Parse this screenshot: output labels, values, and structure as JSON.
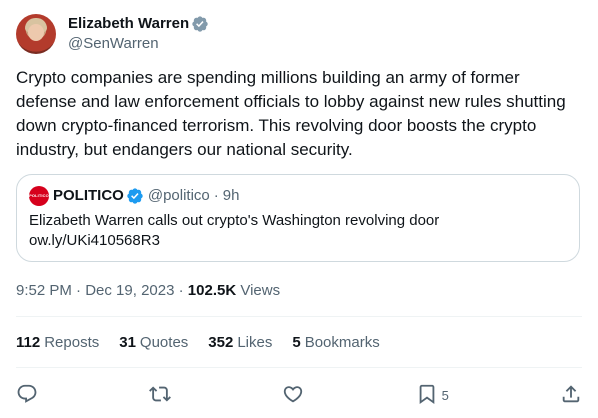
{
  "author": {
    "display_name": "Elizabeth Warren",
    "handle": "@SenWarren",
    "verified": true
  },
  "tweet": {
    "text": "Crypto companies are spending millions building an army of former defense and law enforcement officials to lobby against new rules shutting down crypto-financed terrorism. This revolving door boosts the crypto industry, but endangers our national security."
  },
  "quote": {
    "logo_text": "POLITICO",
    "name": "POLITICO",
    "handle": "@politico",
    "separator": "·",
    "time": "9h",
    "line1": "Elizabeth Warren calls out crypto's Washington revolving door",
    "line2": "ow.ly/UKi410568R3"
  },
  "meta": {
    "time": "9:52 PM",
    "sep1": " · ",
    "date": "Dec 19, 2023",
    "sep2": " · ",
    "views": "102.5K",
    "views_label": " Views"
  },
  "stats": {
    "reposts": {
      "count": "112",
      "label": "Reposts"
    },
    "quotes": {
      "count": "31",
      "label": "Quotes"
    },
    "likes": {
      "count": "352",
      "label": "Likes"
    },
    "bookmarks": {
      "count": "5",
      "label": "Bookmarks"
    }
  },
  "actions": {
    "reply": {
      "icon": "reply-icon"
    },
    "repost": {
      "icon": "repost-icon"
    },
    "like": {
      "icon": "heart-icon"
    },
    "bookmark": {
      "icon": "bookmark-icon",
      "count": "5"
    },
    "share": {
      "icon": "share-icon"
    }
  },
  "colors": {
    "text_primary": "#0f1419",
    "text_secondary": "#536471",
    "verified_blue": "#1d9bf0",
    "border": "#cfd9de",
    "politico_red": "#d6001c"
  }
}
